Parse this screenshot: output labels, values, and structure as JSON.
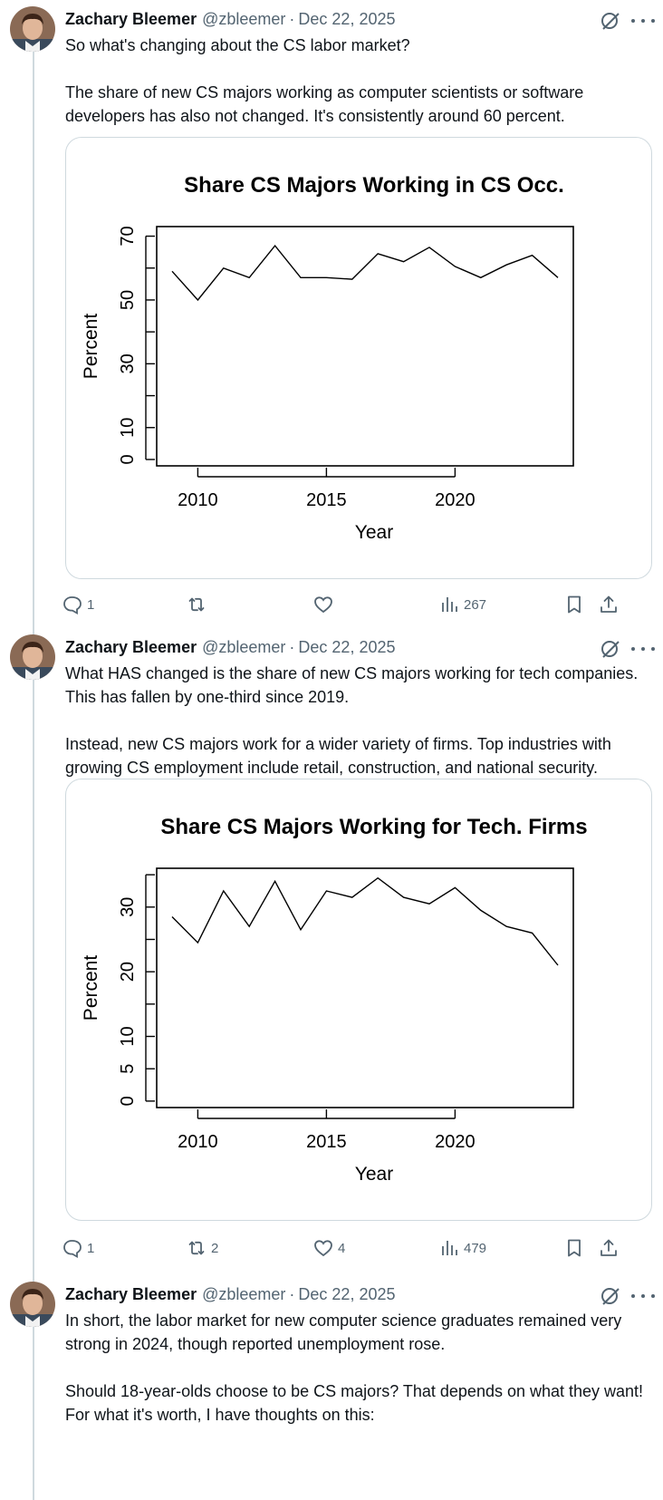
{
  "tweets": [
    {
      "name": "Zachary Bleemer",
      "handle": "@zbleemer",
      "separator": "·",
      "date": "Dec 22, 2025",
      "paragraphs": [
        "So what's changing about the CS labor market?",
        "The share of new CS majors working as computer scientists or software developers has also not changed. It's consistently around 60 percent."
      ],
      "actions": {
        "replies": "1",
        "reposts": "",
        "likes": "",
        "views": "267"
      }
    },
    {
      "name": "Zachary Bleemer",
      "handle": "@zbleemer",
      "separator": "·",
      "date": "Dec 22, 2025",
      "paragraphs": [
        "What HAS changed is the share of new CS majors working for tech companies. This has fallen by one-third since 2019.",
        "Instead, new CS majors work for a wider variety of firms. Top industries with growing CS employment include retail, construction, and national security."
      ],
      "actions": {
        "replies": "1",
        "reposts": "2",
        "likes": "4",
        "views": "479"
      }
    },
    {
      "name": "Zachary Bleemer",
      "handle": "@zbleemer",
      "separator": "·",
      "date": "Dec 22, 2025",
      "paragraphs": [
        "In short, the labor market for new computer science graduates remained very strong in 2024, though reported unemployment rose.",
        "Should 18-year-olds choose to be CS majors? That depends on what they want! For what it's worth, I have thoughts on this:"
      ]
    }
  ],
  "icons": {
    "reply": "reply-icon",
    "repost": "repost-icon",
    "like": "heart-icon",
    "views": "views-icon",
    "bookmark": "bookmark-icon",
    "share": "share-icon",
    "grok": "grok-icon",
    "more": "more-icon"
  },
  "colors": {
    "text": "#0f1419",
    "secondary": "#536471",
    "border": "#cfd9de"
  },
  "chart_data": [
    {
      "type": "line",
      "title": "Share CS Majors Working in CS Occ.",
      "xlabel": "Year",
      "ylabel": "Percent",
      "xlim": [
        2009,
        2024
      ],
      "ylim": [
        -2,
        73
      ],
      "xticks": [
        2010,
        2015,
        2020
      ],
      "yticks": [
        0,
        10,
        20,
        30,
        40,
        50,
        60,
        70
      ],
      "ytick_labels": [
        "0",
        "10",
        "",
        "30",
        "",
        "50",
        "",
        "70"
      ],
      "grid": false,
      "x": [
        2009,
        2010,
        2011,
        2012,
        2013,
        2014,
        2015,
        2016,
        2017,
        2018,
        2019,
        2020,
        2021,
        2022,
        2023,
        2024
      ],
      "y": [
        59,
        50,
        60,
        57,
        67,
        57,
        57,
        56.5,
        64.5,
        62,
        66.5,
        60.5,
        57,
        61,
        64,
        57
      ]
    },
    {
      "type": "line",
      "title": "Share CS Majors Working for Tech. Firms",
      "xlabel": "Year",
      "ylabel": "Percent",
      "xlim": [
        2009,
        2024
      ],
      "ylim": [
        -1,
        36
      ],
      "xticks": [
        2010,
        2015,
        2020
      ],
      "yticks": [
        0,
        5,
        10,
        15,
        20,
        25,
        30,
        35
      ],
      "ytick_labels": [
        "0",
        "5",
        "10",
        "",
        "20",
        "",
        "30",
        ""
      ],
      "grid": false,
      "x": [
        2009,
        2010,
        2011,
        2012,
        2013,
        2014,
        2015,
        2016,
        2017,
        2018,
        2019,
        2020,
        2021,
        2022,
        2023,
        2024
      ],
      "y": [
        28.5,
        24.5,
        32.5,
        27,
        34,
        26.5,
        32.5,
        31.5,
        34.5,
        31.5,
        30.5,
        33,
        29.5,
        27,
        26,
        21
      ]
    }
  ]
}
